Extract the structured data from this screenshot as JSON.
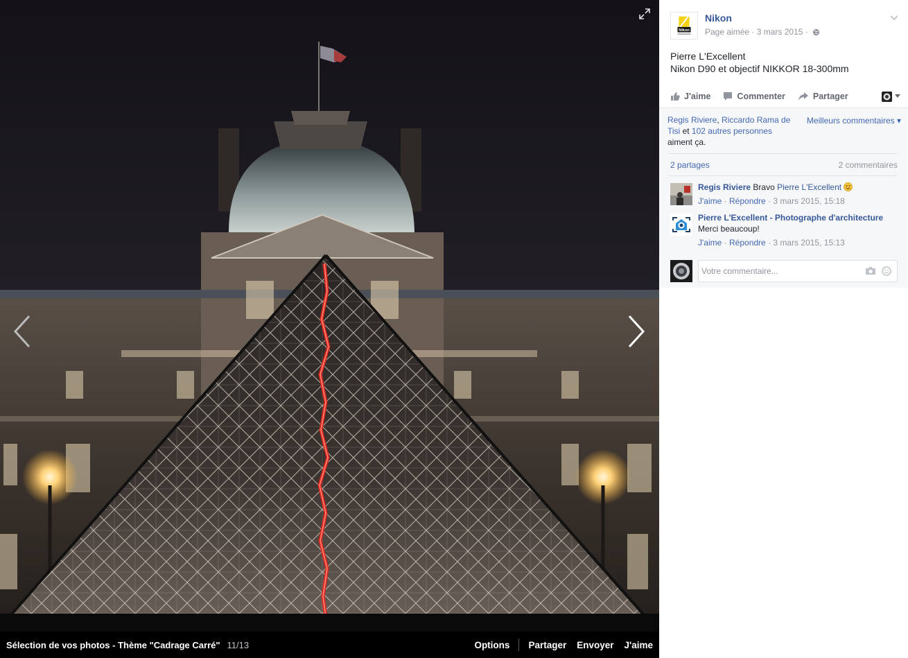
{
  "photo_viewer": {
    "album_title": "Sélection de vos photos - Thème \"Cadrage Carré\"",
    "position": "11/13",
    "footer_actions": {
      "options": "Options",
      "share": "Partager",
      "send": "Envoyer",
      "like": "J'aime"
    }
  },
  "post": {
    "page_name": "Nikon",
    "status": "Page aimée",
    "date": "3 mars 2015",
    "caption_line1": "Pierre L'Excellent",
    "caption_line2": "Nikon D90 et objectif NIKKOR 18-300mm",
    "actions": {
      "like": "J'aime",
      "comment": "Commenter",
      "share": "Partager"
    }
  },
  "feedback": {
    "liker1": "Regis Riviere",
    "liker2": "Riccardo Rama de Tisi",
    "and_word": "et",
    "others": "102 autres personnes",
    "like_suffix": "aiment ça.",
    "sort_label": "Meilleurs commentaires",
    "shares": "2 partages",
    "comments_count": "2 commentaires"
  },
  "comments": [
    {
      "author": "Regis Riviere",
      "text": "Bravo",
      "mention": "Pierre L'Excellent",
      "like": "J'aime",
      "reply": "Répondre",
      "time": "3 mars 2015, 15:18"
    },
    {
      "author": "Pierre L'Excellent - Photographe d'architecture",
      "text": "Merci beaucoup!",
      "like": "J'aime",
      "reply": "Répondre",
      "time": "3 mars 2015, 15:13"
    }
  ],
  "composer": {
    "placeholder": "Votre commentaire..."
  },
  "logo": {
    "text": "Nikon"
  },
  "colors": {
    "link": "#365899",
    "accent_red": "#e0241b",
    "nikon_yellow": "#f7d117"
  },
  "icons": [
    "expand-icon",
    "chevron-left-icon",
    "chevron-right-icon",
    "chevron-down-icon",
    "globe-icon",
    "like-icon",
    "comment-icon",
    "share-icon",
    "smiley-icon",
    "camera-icon",
    "emoji-icon"
  ]
}
